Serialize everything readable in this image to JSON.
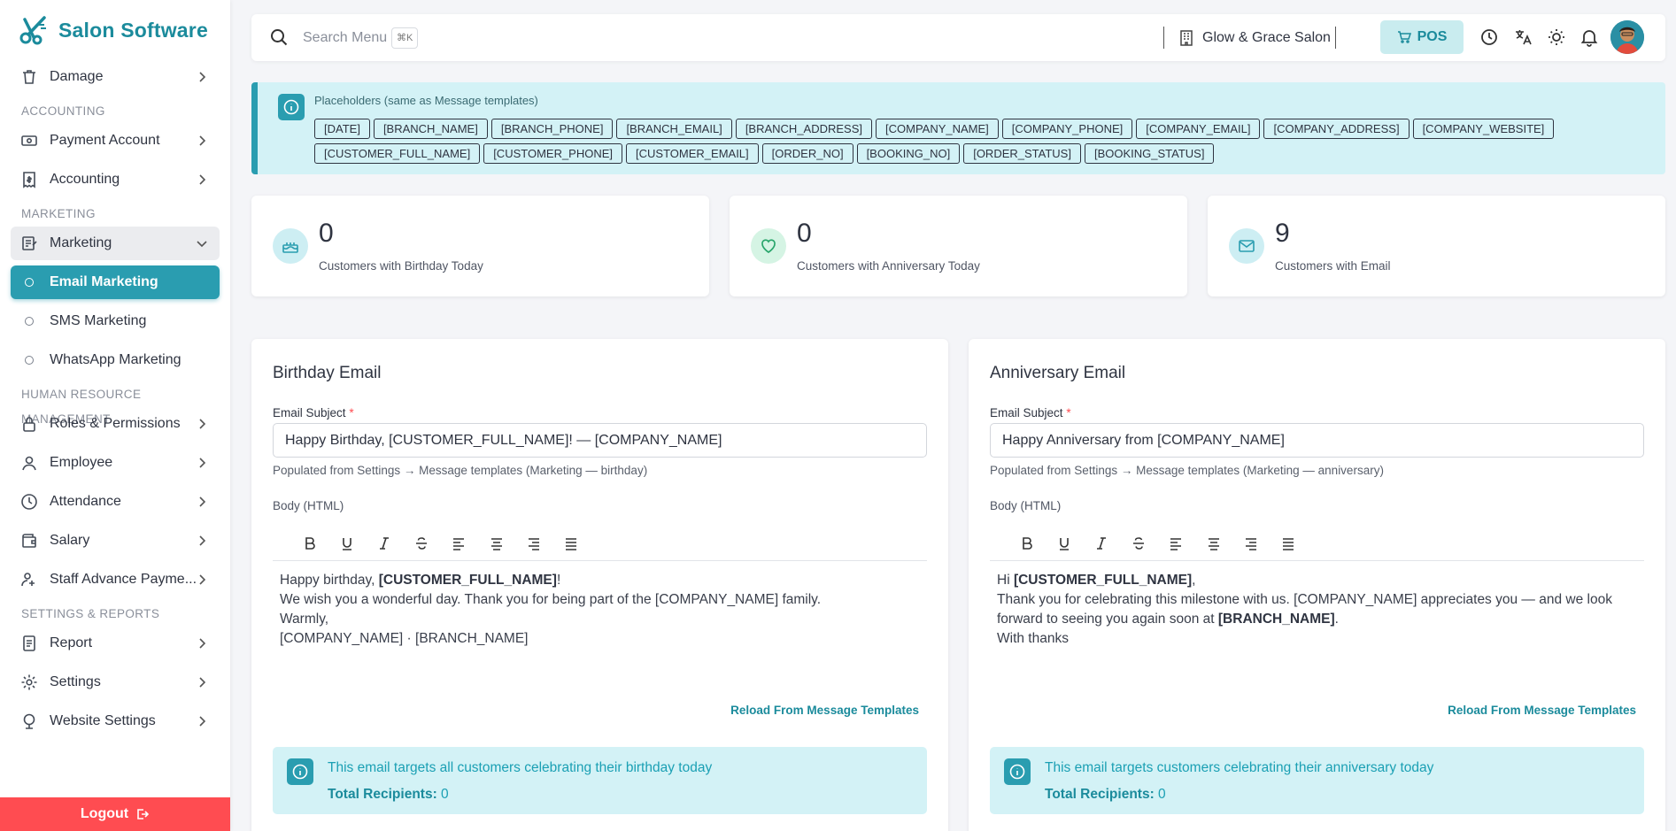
{
  "app": {
    "name": "Salon Software"
  },
  "sidebar": {
    "items": [
      {
        "type": "item",
        "label": "Damage",
        "icon": "trash-icon",
        "chevron": true
      },
      {
        "type": "section",
        "label": "ACCOUNTING"
      },
      {
        "type": "item",
        "label": "Payment Account",
        "icon": "cash-icon",
        "chevron": true
      },
      {
        "type": "item",
        "label": "Accounting",
        "icon": "receipt-icon",
        "chevron": true
      },
      {
        "type": "section",
        "label": "MARKETING"
      },
      {
        "type": "item",
        "label": "Marketing",
        "icon": "marketing-icon",
        "chevron": true,
        "open": true
      },
      {
        "type": "sub",
        "label": "Email Marketing",
        "active": true
      },
      {
        "type": "sub",
        "label": "SMS Marketing"
      },
      {
        "type": "sub",
        "label": "WhatsApp Marketing"
      },
      {
        "type": "section",
        "label": "HUMAN RESOURCE MANAGEMENT"
      },
      {
        "type": "item",
        "label": "Roles & Permissions",
        "icon": "lock-icon",
        "chevron": true
      },
      {
        "type": "item",
        "label": "Employee",
        "icon": "user-icon",
        "chevron": true
      },
      {
        "type": "item",
        "label": "Attendance",
        "icon": "clock-icon",
        "chevron": true
      },
      {
        "type": "item",
        "label": "Salary",
        "icon": "wallet-icon",
        "chevron": true
      },
      {
        "type": "item",
        "label": "Staff Advance Payme...",
        "icon": "staff-advance-icon",
        "chevron": true
      },
      {
        "type": "section",
        "label": "SETTINGS & REPORTS"
      },
      {
        "type": "item",
        "label": "Report",
        "icon": "report-icon",
        "chevron": true
      },
      {
        "type": "item",
        "label": "Settings",
        "icon": "gear-icon",
        "chevron": true
      },
      {
        "type": "item",
        "label": "Website Settings",
        "icon": "globe-icon",
        "chevron": true
      }
    ],
    "logout_label": "Logout"
  },
  "topbar": {
    "search_placeholder": "Search Menu",
    "shortcut": "⌘K",
    "branch": "Glow & Grace Salon",
    "pos_label": "POS"
  },
  "placeholders": {
    "title": "Placeholders (same as Message templates)",
    "chips": [
      "[DATE]",
      "[BRANCH_NAME]",
      "[BRANCH_PHONE]",
      "[BRANCH_EMAIL]",
      "[BRANCH_ADDRESS]",
      "[COMPANY_NAME]",
      "[COMPANY_PHONE]",
      "[COMPANY_EMAIL]",
      "[COMPANY_ADDRESS]",
      "[COMPANY_WEBSITE]",
      "[CUSTOMER_FULL_NAME]",
      "[CUSTOMER_PHONE]",
      "[CUSTOMER_EMAIL]",
      "[ORDER_NO]",
      "[BOOKING_NO]",
      "[ORDER_STATUS]",
      "[BOOKING_STATUS]"
    ]
  },
  "stats": [
    {
      "value": "0",
      "label": "Customers with Birthday Today",
      "icon": "cake-icon"
    },
    {
      "value": "0",
      "label": "Customers with Anniversary Today",
      "icon": "heart-icon"
    },
    {
      "value": "9",
      "label": "Customers with Email",
      "icon": "mail-icon"
    }
  ],
  "birthday": {
    "title": "Birthday Email",
    "subject_label": "Email Subject",
    "subject": "Happy Birthday, [CUSTOMER_FULL_NAME]! — [COMPANY_NAME]",
    "help": "Populated from Settings → Message templates (Marketing — birthday)",
    "body_label": "Body (HTML)",
    "body_l1_pre": "Happy birthday, ",
    "body_l1_bold": "[CUSTOMER_FULL_NAME]",
    "body_l1_post": "!",
    "body_l2": "We wish you a wonderful day. Thank you for being part of the [COMPANY_NAME] family.",
    "body_l3": "Warmly,",
    "body_l4": "[COMPANY_NAME] · [BRANCH_NAME]",
    "reload": "Reload From Message Templates",
    "alert_text": "This email targets all customers celebrating their birthday today",
    "recipients_label": "Total Recipients:",
    "recipients_value": "0"
  },
  "anniversary": {
    "title": "Anniversary Email",
    "subject_label": "Email Subject",
    "subject": "Happy Anniversary from [COMPANY_NAME]",
    "help": "Populated from Settings → Message templates (Marketing — anniversary)",
    "body_label": "Body (HTML)",
    "body_l1_pre": "Hi ",
    "body_l1_bold": "[CUSTOMER_FULL_NAME]",
    "body_l1_post": ",",
    "body_l2": "Thank you for celebrating this milestone with us. [COMPANY_NAME] appreciates you — and we look forward to seeing you again soon at ",
    "body_l2_bold": "[BRANCH_NAME]",
    "body_l2_post": ".",
    "body_l3": "With thanks",
    "reload": "Reload From Message Templates",
    "alert_text": "This email targets customers celebrating their anniversary today",
    "recipients_label": "Total Recipients:",
    "recipients_value": "0"
  },
  "colors": {
    "accent": "#2a9db0",
    "brand": "#1b8b9c",
    "danger": "#ff4c51",
    "info_bg": "#d3f2f6"
  }
}
